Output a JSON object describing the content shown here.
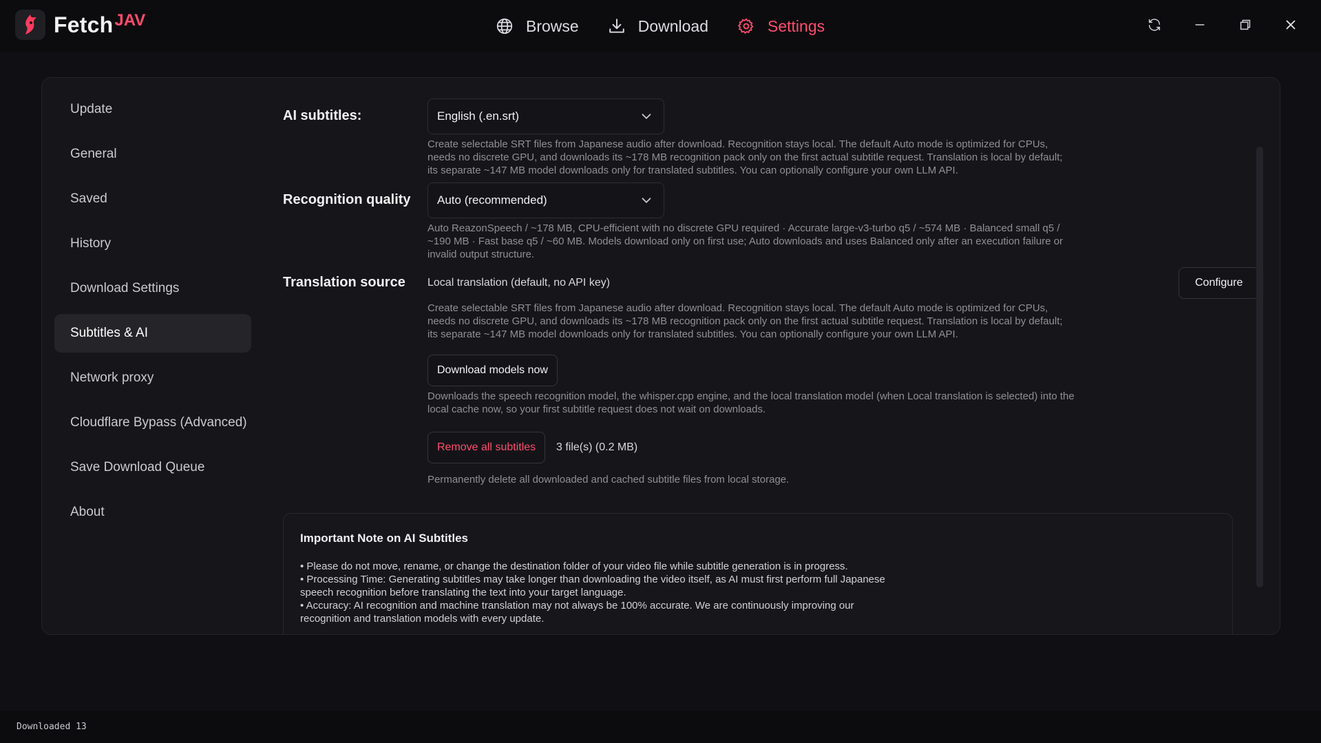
{
  "app": {
    "logo_text": "Fetch",
    "logo_sup": "JAV",
    "accent": "#ff4d6d"
  },
  "nav": {
    "browse": "Browse",
    "download": "Download",
    "settings": "Settings"
  },
  "sidebar": {
    "items": [
      {
        "label": "Update"
      },
      {
        "label": "General"
      },
      {
        "label": "Saved"
      },
      {
        "label": "History"
      },
      {
        "label": "Download Settings"
      },
      {
        "label": "Subtitles & AI"
      },
      {
        "label": "Network proxy"
      },
      {
        "label": "Cloudflare Bypass (Advanced)"
      },
      {
        "label": "Save Download Queue"
      },
      {
        "label": "About"
      }
    ],
    "active": "Subtitles & AI"
  },
  "settings": {
    "ai_subtitles": {
      "label": "AI subtitles:",
      "value": "English (.en.srt)",
      "desc": "Create selectable SRT files from Japanese audio after download. Recognition stays local. The default Auto mode is optimized for CPUs, needs no discrete GPU, and downloads its ~178 MB recognition pack only on the first actual subtitle request. Translation is local by default; its separate ~147 MB model downloads only for translated subtitles. You can optionally configure your own LLM API."
    },
    "recognition_quality": {
      "label": "Recognition quality",
      "value": "Auto (recommended)",
      "desc": "Auto ReazonSpeech / ~178 MB, CPU-efficient with no discrete GPU required · Accurate large-v3-turbo q5 / ~574 MB · Balanced small q5 / ~190 MB · Fast base q5 / ~60 MB. Models download only on first use; Auto downloads and uses Balanced only after an execution failure or invalid output structure."
    },
    "translation_source": {
      "label": "Translation source",
      "value": "Local translation (default, no API key)",
      "configure_button": "Configure",
      "desc": "Create selectable SRT files from Japanese audio after download. Recognition stays local. The default Auto mode is optimized for CPUs, needs no discrete GPU, and downloads its ~178 MB recognition pack only on the first actual subtitle request. Translation is local by default; its separate ~147 MB model downloads only for translated subtitles. You can optionally configure your own LLM API."
    },
    "download_models": {
      "button": "Download models now",
      "desc": "Downloads the speech recognition model, the whisper.cpp engine, and the local translation model (when Local translation is selected) into the local cache now, so your first subtitle request does not wait on downloads."
    },
    "remove_subtitles": {
      "button": "Remove all subtitles",
      "count": "3 file(s) (0.2 MB)",
      "desc": "Permanently delete all downloaded and cached subtitle files from local storage."
    },
    "note": {
      "title": "Important Note on AI Subtitles",
      "lines": [
        "• Please do not move, rename, or change the destination folder of your video file while subtitle generation is in progress.",
        "• Processing Time: Generating subtitles may take longer than downloading the video itself, as AI must first perform full Japanese speech recognition before translating the text into your target language.",
        "• Accuracy: AI recognition and machine translation may not always be 100% accurate. We are continuously improving our recognition and translation models with every update."
      ]
    }
  },
  "status_bar": {
    "text": "Downloaded 13"
  }
}
